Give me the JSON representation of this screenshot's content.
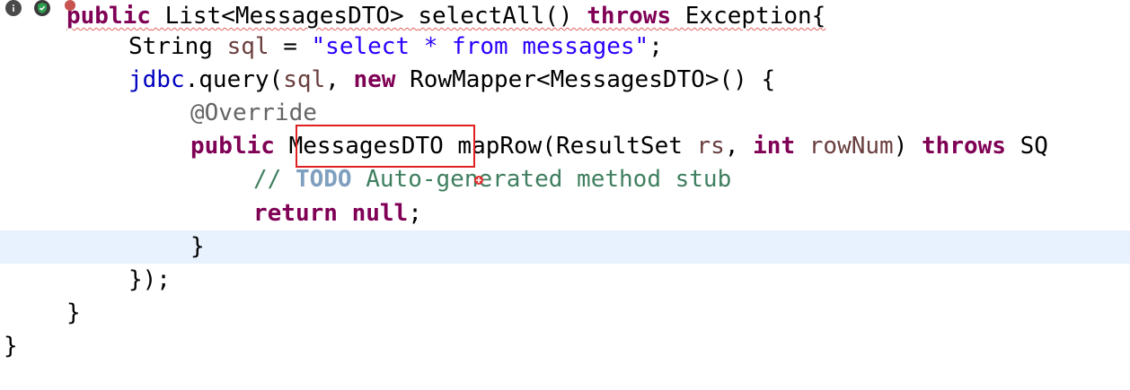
{
  "editor": {
    "lines": [
      {
        "p1": "public",
        "p2": " List<MessagesDTO> ",
        "p3": "selectAll() ",
        "p4": "throws",
        "p5": " Exception{"
      },
      {
        "p1": "String ",
        "p2": "sql",
        "p3": " = ",
        "p4": "\"select * from messages\"",
        "p5": ";"
      },
      {
        "p1": "jdbc",
        "p2": ".query(",
        "p3": "sql",
        "p4": ", ",
        "p5": "new",
        "p6": " RowMapper<MessagesDTO>() {"
      },
      {
        "p1": "@Override"
      },
      {
        "p1": "public",
        "p2": " ",
        "p3": "MessagesDTO",
        "p4": " mapRow(ResultSet ",
        "p5": "rs",
        "p6": ", ",
        "p7": "int",
        "p8": " ",
        "p9": "rowNum",
        "p10": ") ",
        "p11": "throws",
        "p12": " SQ"
      },
      {
        "p1": "// ",
        "p2": "TODO",
        "p3": " Auto-generated method stub"
      },
      {
        "p1": "return",
        "p2": " ",
        "p3": "null",
        "p4": ";"
      },
      {
        "p1": "}"
      },
      {
        "p1": "});"
      },
      {
        "p1": "}"
      },
      {
        "p1": "}"
      }
    ]
  },
  "colors": {
    "keyword": "#7f0055",
    "string": "#2a00ff",
    "field": "#0000c0",
    "comment": "#3f7f5f",
    "highlight_box": "#e02020",
    "current_line": "#e8f2fe"
  },
  "icons": [
    "info-icon",
    "shield-check-icon",
    "error-marker-icon"
  ]
}
